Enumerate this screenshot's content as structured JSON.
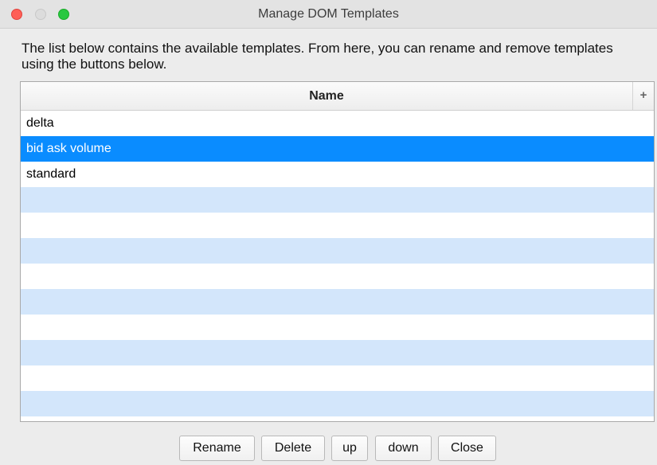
{
  "window": {
    "title": "Manage DOM Templates"
  },
  "description": "The list below contains the available templates.  From here, you can rename and remove templates using the buttons below.",
  "table": {
    "column_name": "Name",
    "add_column_glyph": "+",
    "rows": [
      {
        "label": "delta",
        "selected": false
      },
      {
        "label": "bid ask volume",
        "selected": true
      },
      {
        "label": "standard",
        "selected": false
      },
      {
        "label": "",
        "selected": false
      },
      {
        "label": "",
        "selected": false
      },
      {
        "label": "",
        "selected": false
      },
      {
        "label": "",
        "selected": false
      },
      {
        "label": "",
        "selected": false
      },
      {
        "label": "",
        "selected": false
      },
      {
        "label": "",
        "selected": false
      },
      {
        "label": "",
        "selected": false
      },
      {
        "label": "",
        "selected": false
      }
    ]
  },
  "buttons": {
    "rename": "Rename",
    "delete": "Delete",
    "up": "up",
    "down": "down",
    "close": "Close"
  },
  "colors": {
    "selection": "#0a8cff",
    "stripe": "#d3e6fb",
    "close_light": "#fe5f57",
    "max_light": "#28c840"
  }
}
